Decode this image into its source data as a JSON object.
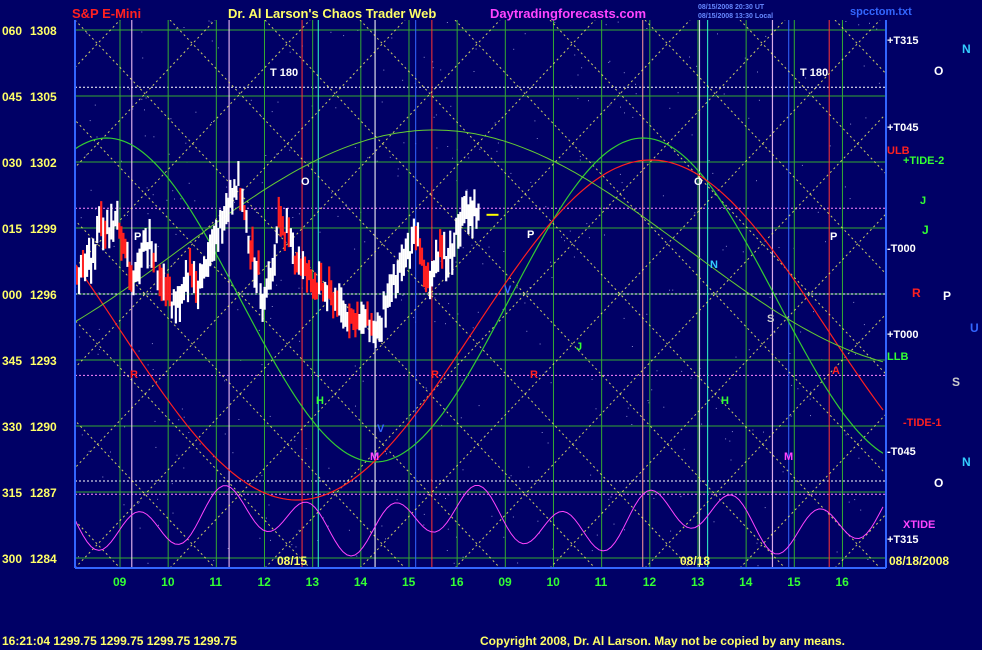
{
  "header": {
    "symbol": "S&P E-Mini",
    "title": "Dr. Al Larson's Chaos Trader Web",
    "site": "Daytradingforecasts.com",
    "timestamp1": "08/15/2008 20:30 UT",
    "timestamp2": "08/15/2008 13:30 Local",
    "file": "spcctom.txt"
  },
  "footer": {
    "quote": "16:21:04  1299.75  1299.75  1299.75  1299.75",
    "copyright": "Copyright 2008, Dr. Al Larson. May not be copied by any means."
  },
  "colors": {
    "background": "#000066",
    "price": "#ffffff",
    "price_down": "#ff2020",
    "grid_green": "#33cc33",
    "grid_yellow": "#ffff66",
    "red_line": "#ff2020",
    "xtide": "#ff44ff"
  },
  "chart_data": {
    "type": "line",
    "y_left_ticks": [
      "060",
      "045",
      "030",
      "015",
      "000",
      "345",
      "330",
      "315",
      "300"
    ],
    "y_right_ticks": [
      "1308",
      "1305",
      "1302",
      "1299",
      "1296",
      "1293",
      "1290",
      "1287",
      "1284"
    ],
    "ylim": [
      1284,
      1309
    ],
    "x_ticks": [
      "09",
      "10",
      "11",
      "12",
      "13",
      "14",
      "15",
      "16",
      "09",
      "10",
      "11",
      "12",
      "13",
      "14",
      "15",
      "16"
    ],
    "date_labels": [
      "08/15",
      "08/18",
      "08/18/2008"
    ],
    "right_labels": [
      {
        "text": "+T315",
        "color": "#ffffff"
      },
      {
        "text": "+T045",
        "color": "#ffffff"
      },
      {
        "text": "ULB",
        "color": "#ff2020"
      },
      {
        "text": "+TIDE-2",
        "color": "#33ff33"
      },
      {
        "text": "-T000",
        "color": "#ffffff"
      },
      {
        "text": "+T000",
        "color": "#ffffff"
      },
      {
        "text": "LLB",
        "color": "#33ff33"
      },
      {
        "text": "-TIDE-1",
        "color": "#ff2020"
      },
      {
        "text": "-T045",
        "color": "#ffffff"
      },
      {
        "text": "XTIDE",
        "color": "#ff44ff"
      },
      {
        "text": "+T315",
        "color": "#ffffff"
      }
    ],
    "planet_labels": [
      {
        "text": "N",
        "color": "#33ccff"
      },
      {
        "text": "O",
        "color": "#ffffff"
      },
      {
        "text": "J",
        "color": "#33ff33"
      },
      {
        "text": "R",
        "color": "#ff2020"
      },
      {
        "text": "P",
        "color": "#ffffff"
      },
      {
        "text": "U",
        "color": "#3366ff"
      },
      {
        "text": "S",
        "color": "#cccccc"
      },
      {
        "text": "N",
        "color": "#33ccff"
      },
      {
        "text": "O",
        "color": "#ffffff"
      }
    ],
    "in_chart_labels": [
      "T 180",
      "T 180",
      "O",
      "O",
      "P",
      "P",
      "P",
      "V",
      "N",
      "R",
      "R",
      "R",
      "J",
      "J",
      "H",
      "H",
      "M",
      "M",
      "V",
      "S",
      "A"
    ],
    "price_series": [
      {
        "t": 0.0,
        "v": 1297.2
      },
      {
        "t": 0.02,
        "v": 1297.0
      },
      {
        "t": 0.04,
        "v": 1298.0
      },
      {
        "t": 0.06,
        "v": 1299.2
      },
      {
        "t": 0.08,
        "v": 1298.8
      },
      {
        "t": 0.1,
        "v": 1299.5
      },
      {
        "t": 0.12,
        "v": 1297.5
      },
      {
        "t": 0.14,
        "v": 1296.5
      },
      {
        "t": 0.16,
        "v": 1297.8
      },
      {
        "t": 0.18,
        "v": 1298.6
      },
      {
        "t": 0.2,
        "v": 1297.0
      },
      {
        "t": 0.22,
        "v": 1296.2
      },
      {
        "t": 0.24,
        "v": 1295.5
      },
      {
        "t": 0.26,
        "v": 1296.0
      },
      {
        "t": 0.28,
        "v": 1297.0
      },
      {
        "t": 0.3,
        "v": 1296.2
      },
      {
        "t": 0.32,
        "v": 1297.5
      },
      {
        "t": 0.34,
        "v": 1298.2
      },
      {
        "t": 0.36,
        "v": 1299.5
      },
      {
        "t": 0.38,
        "v": 1300.5
      },
      {
        "t": 0.4,
        "v": 1301.0
      },
      {
        "t": 0.42,
        "v": 1299.0
      },
      {
        "t": 0.44,
        "v": 1297.5
      },
      {
        "t": 0.46,
        "v": 1296.0
      },
      {
        "t": 0.48,
        "v": 1296.5
      },
      {
        "t": 0.5,
        "v": 1299.4
      },
      {
        "t": 0.52,
        "v": 1298.8
      },
      {
        "t": 0.54,
        "v": 1297.8
      },
      {
        "t": 0.56,
        "v": 1297.2
      },
      {
        "t": 0.58,
        "v": 1296.6
      },
      {
        "t": 0.6,
        "v": 1296.4
      },
      {
        "t": 0.62,
        "v": 1296.0
      },
      {
        "t": 0.64,
        "v": 1295.8
      },
      {
        "t": 0.66,
        "v": 1295.2
      },
      {
        "t": 0.68,
        "v": 1295.0
      },
      {
        "t": 0.7,
        "v": 1294.6
      },
      {
        "t": 0.72,
        "v": 1294.9
      },
      {
        "t": 0.74,
        "v": 1294.2
      },
      {
        "t": 0.76,
        "v": 1295.2
      },
      {
        "t": 0.78,
        "v": 1296.2
      },
      {
        "t": 0.8,
        "v": 1297.0
      },
      {
        "t": 0.82,
        "v": 1297.8
      },
      {
        "t": 0.84,
        "v": 1298.6
      },
      {
        "t": 0.86,
        "v": 1297.0
      },
      {
        "t": 0.88,
        "v": 1296.8
      },
      {
        "t": 0.9,
        "v": 1298.2
      },
      {
        "t": 0.92,
        "v": 1297.6
      },
      {
        "t": 0.94,
        "v": 1298.8
      },
      {
        "t": 0.96,
        "v": 1299.5
      },
      {
        "t": 0.98,
        "v": 1299.7
      },
      {
        "t": 1.0,
        "v": 1299.75
      }
    ]
  }
}
